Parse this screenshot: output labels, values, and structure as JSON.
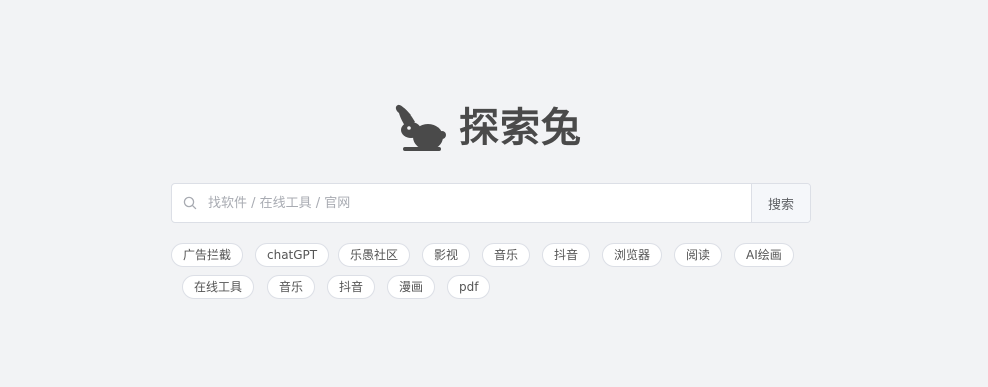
{
  "brand": {
    "title": "探索兔",
    "logo_icon": "rabbit-icon"
  },
  "search": {
    "placeholder": "找软件 / 在线工具 / 官网",
    "value": "",
    "button_label": "搜索",
    "icon": "search-icon"
  },
  "tags": {
    "row1": [
      "广告拦截",
      "chatGPT",
      "乐愚社区",
      "影视",
      "音乐",
      "抖音",
      "浏览器",
      "阅读",
      "AI绘画"
    ],
    "row2": [
      "在线工具",
      "音乐",
      "抖音",
      "漫画",
      "pdf"
    ]
  },
  "colors": {
    "background": "#f2f3f5",
    "brand_text": "#4a4a4a",
    "border": "#dcdfe6",
    "button_bg": "#f5f7fa",
    "placeholder": "#a8abb2"
  }
}
